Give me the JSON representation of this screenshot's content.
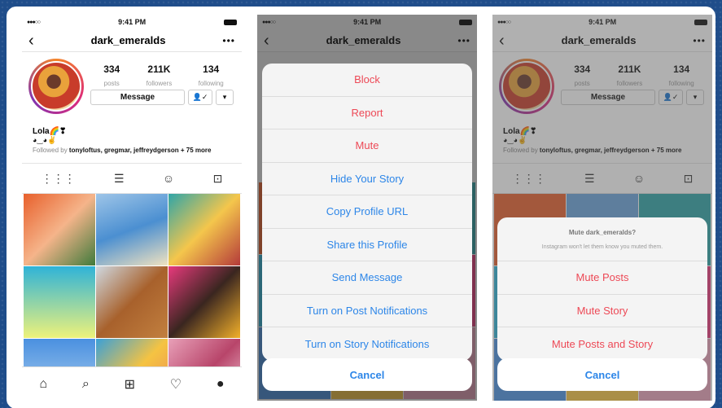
{
  "status": {
    "carrier": "●●●○○",
    "time": "9:41 PM"
  },
  "profile": {
    "username": "dark_emeralds",
    "posts": "334",
    "posts_label": "posts",
    "followers": "211K",
    "followers_label": "followers",
    "following": "134",
    "following_label": "following",
    "message_button": "Message",
    "name": "Lola🌈❣",
    "bio": "◕‿◕✌",
    "followed_prefix": "Followed by ",
    "followed_names": "tonyloftus, gregmar, jeffreydgerson",
    "followed_more": " + 75 more"
  },
  "menu": [
    {
      "label": "Block",
      "color": "red"
    },
    {
      "label": "Report",
      "color": "red"
    },
    {
      "label": "Mute",
      "color": "red"
    },
    {
      "label": "Hide Your Story",
      "color": "blue"
    },
    {
      "label": "Copy Profile URL",
      "color": "blue"
    },
    {
      "label": "Share this Profile",
      "color": "blue"
    },
    {
      "label": "Send Message",
      "color": "blue"
    },
    {
      "label": "Turn on Post Notifications",
      "color": "blue"
    },
    {
      "label": "Turn on Story Notifications",
      "color": "blue"
    }
  ],
  "cancel_label": "Cancel",
  "mute_sheet": {
    "title": "Mute dark_emeralds?",
    "subtitle": "Instagram won't let them know you muted them.",
    "options": [
      "Mute Posts",
      "Mute Story",
      "Mute Posts and Story"
    ]
  },
  "colors": {
    "accent_red": "#ed4956",
    "accent_blue": "#2d86e8",
    "background": "#1f4d8a"
  }
}
